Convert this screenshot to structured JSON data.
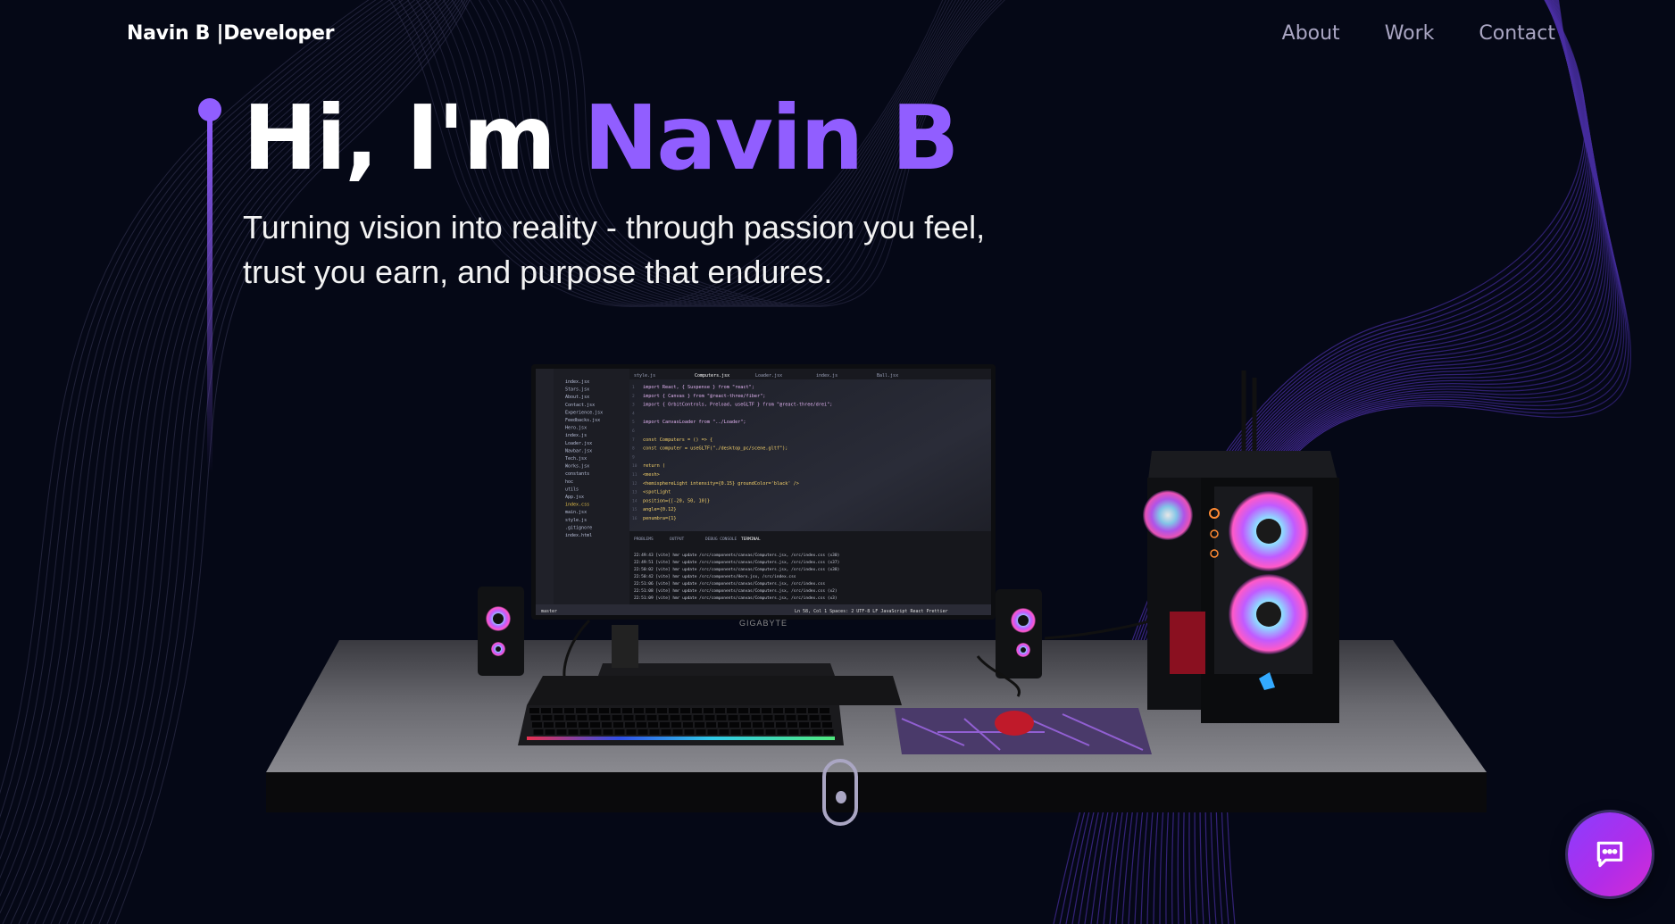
{
  "brand": {
    "name": "Navin B",
    "separator": "|",
    "role": "Developer"
  },
  "nav": {
    "links": [
      "About",
      "Work",
      "Contact"
    ]
  },
  "hero": {
    "greeting": "Hi, I'm ",
    "name": "Navin B",
    "subtitle_line1": "Turning vision into reality - through passion you feel,",
    "subtitle_line2": "trust you earn, and purpose that endures."
  },
  "scene": {
    "monitor_brand": "GIGABYTE",
    "editor": {
      "tabs": [
        "style.js",
        "Computers.jsx",
        "Loader.jsx",
        "index.js",
        "Ball.jsx"
      ],
      "code_lines": [
        "import React, { Suspense } from \"react\";",
        "import { Canvas } from \"@react-three/fiber\";",
        "import { OrbitControls, Preload, useGLTF } from \"@react-three/drei\";",
        "",
        "import CanvasLoader from \"../Loader\";",
        "",
        "const Computers = () => {",
        "  const computer = useGLTF(\"./desktop_pc/scene.gltf\");",
        "",
        "  return (",
        "    <mesh>",
        "      <hemisphereLight intensity={0.15} groundColor='black' />",
        "      <spotLight",
        "        position={[-20, 50, 10]}",
        "        angle={0.12}",
        "        penumbra={1}"
      ],
      "files": [
        "index.jsx",
        "Stars.jsx",
        "About.jsx",
        "Contact.jsx",
        "Experience.jsx",
        "Feedbacks.jsx",
        "Hero.jsx",
        "index.js",
        "Loader.jsx",
        "Navbar.jsx",
        "Tech.jsx",
        "Works.jsx",
        "constants",
        "hoc",
        "utils",
        "App.jsx",
        "index.css",
        "main.jsx",
        "style.js",
        ".gitignore",
        "index.html"
      ],
      "panel_tabs": [
        "PROBLEMS",
        "OUTPUT",
        "DEBUG CONSOLE",
        "TERMINAL"
      ],
      "terminal_lines": [
        "22:49:43 [vite] hmr update /src/components/canvas/Computers.jsx, /src/index.css (x30)",
        "22:49:51 [vite] hmr update /src/components/canvas/Computers.jsx, /src/index.css (x37)",
        "22:50:02 [vite] hmr update /src/components/canvas/Computers.jsx, /src/index.css (x38)",
        "22:50:42 [vite] hmr update /src/components/Hero.jsx, /src/index.css",
        "22:51:06 [vite] hmr update /src/components/canvas/Computers.jsx, /src/index.css",
        "22:51:08 [vite] hmr update /src/components/canvas/Computers.jsx, /src/index.css (x2)",
        "22:51:09 [vite] hmr update /src/components/canvas/Computers.jsx, /src/index.css (x3)"
      ],
      "status_left": "master",
      "status_right": "Ln 58, Col 1   Spaces: 2   UTF-8   LF   JavaScript React   Prettier"
    }
  },
  "colors": {
    "background": "#050816",
    "accent": "#915eff",
    "nav_link": "#aaa6c3",
    "chat_gradient_start": "#8a3dff",
    "chat_gradient_end": "#d42bd4"
  },
  "icons": {
    "scroll": "mouse-scroll-icon",
    "chat": "chat-bubble-icon"
  }
}
